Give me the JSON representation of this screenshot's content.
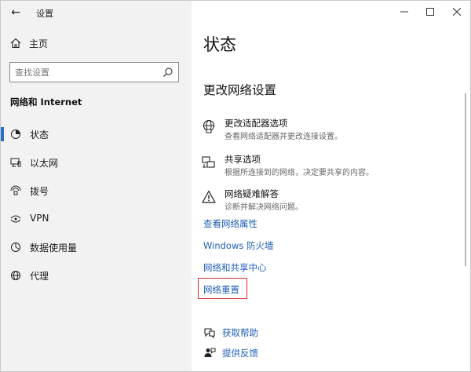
{
  "window": {
    "app_title": "设置",
    "back_glyph": "←",
    "minimize_glyph": "—",
    "maximize_glyph": "☐",
    "close_glyph": "✕"
  },
  "sidebar": {
    "home_label": "主页",
    "search_placeholder": "查找设置",
    "section_header": "网络和 Internet",
    "items": [
      {
        "label": "状态",
        "icon": "status-icon",
        "active": true
      },
      {
        "label": "以太网",
        "icon": "ethernet-icon",
        "active": false
      },
      {
        "label": "拨号",
        "icon": "dialup-icon",
        "active": false
      },
      {
        "label": "VPN",
        "icon": "vpn-icon",
        "active": false
      },
      {
        "label": "数据使用量",
        "icon": "data-usage-icon",
        "active": false
      },
      {
        "label": "代理",
        "icon": "proxy-icon",
        "active": false
      }
    ]
  },
  "main": {
    "page_title": "状态",
    "section_title": "更改网络设置",
    "options": [
      {
        "title": "更改适配器选项",
        "desc": "查看网络适配器并更改连接设置。",
        "icon": "adapter-icon"
      },
      {
        "title": "共享选项",
        "desc": "根据所连接到的网络，决定要共享的内容。",
        "icon": "sharing-icon"
      },
      {
        "title": "网络疑难解答",
        "desc": "诊断并解决网络问题。",
        "icon": "warning-icon"
      }
    ],
    "links": [
      "查看网络属性",
      "Windows 防火墙",
      "网络和共享中心",
      "网络重置"
    ],
    "footer": [
      {
        "label": "获取帮助",
        "icon": "help-icon"
      },
      {
        "label": "提供反馈",
        "icon": "feedback-icon"
      }
    ]
  },
  "colors": {
    "accent": "#2a6fc6",
    "link": "#1f5fb8",
    "highlight_box": "#d62c2c",
    "sidebar_bg": "#f2f2f2"
  }
}
